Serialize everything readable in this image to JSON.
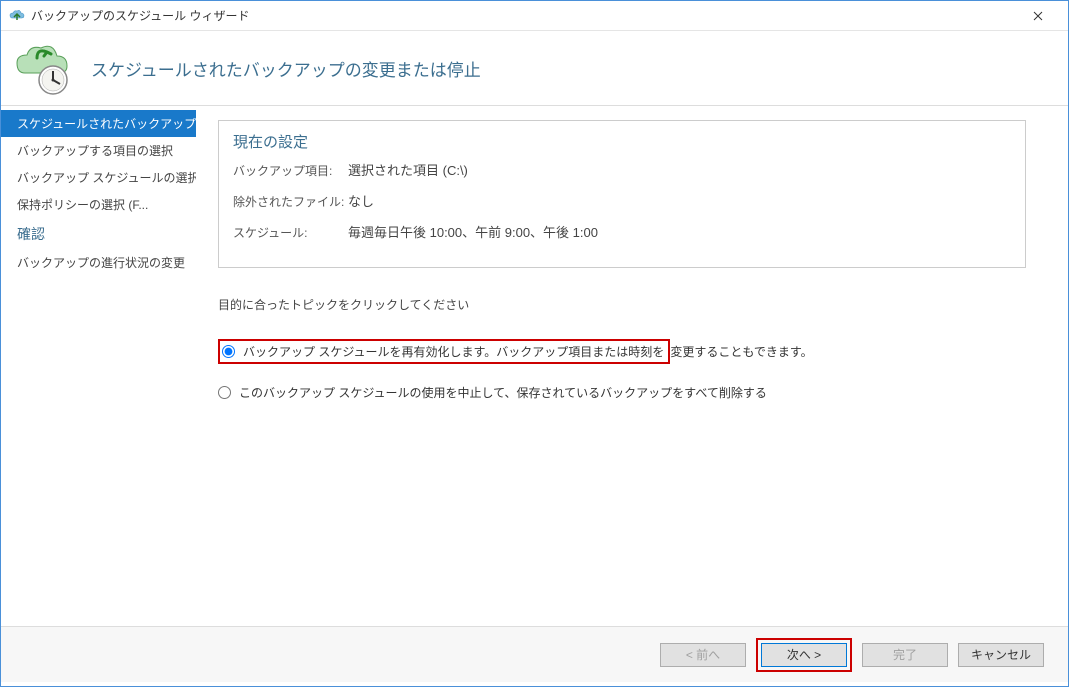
{
  "window": {
    "title": "バックアップのスケジュール ウィザード",
    "close_label": "✕"
  },
  "header": {
    "title": "スケジュールされたバックアップの変更または停止"
  },
  "sidebar": {
    "items": [
      {
        "label": "スケジュールされたバックアップを...",
        "active": true
      },
      {
        "label": "バックアップする項目の選択"
      },
      {
        "label": "バックアップ スケジュールの選択 ..."
      },
      {
        "label": "保持ポリシーの選択 (F..."
      },
      {
        "label": "確認",
        "heading": true
      },
      {
        "label": "バックアップの進行状況の変更"
      }
    ]
  },
  "settings": {
    "title": "現在の設定",
    "rows": [
      {
        "label": "バックアップ項目:",
        "value": "選択された項目 (C:\\)"
      },
      {
        "label": "除外されたファイル:",
        "value": "なし"
      },
      {
        "label": "スケジュール:",
        "value": "毎週毎日午後 10:00、午前 9:00、午後 1:00"
      }
    ]
  },
  "instruction": "目的に合ったトピックをクリックしてください",
  "options": {
    "opt1_part1": "バックアップ スケジュールを再有効化します。バックアップ項目または時刻を",
    "opt1_part2": "変更することもできます。",
    "opt2": "このバックアップ スケジュールの使用を中止して、保存されているバックアップをすべて削除する"
  },
  "footer": {
    "prev": "< 前へ",
    "next": "次へ >",
    "finish": "完了",
    "cancel": "キャンセル"
  }
}
